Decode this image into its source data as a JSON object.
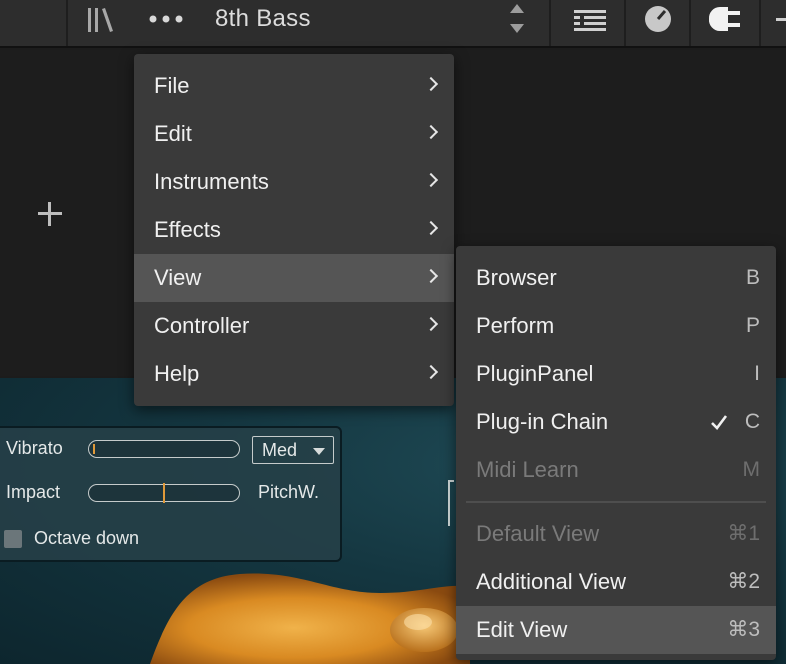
{
  "toolbar": {
    "instrument_name": "8th Bass",
    "icons": [
      "library-icon",
      "more-icon",
      "stepper-icon",
      "list-icon",
      "knob-icon",
      "plug-icon",
      "minus-icon"
    ]
  },
  "rack": {
    "add_icon": "plus-icon"
  },
  "controls": {
    "vibrato_label": "Vibrato",
    "vibrato_mode": "Med",
    "impact_label": "Impact",
    "pitchw_label": "PitchW.",
    "octave_label": "Octave down",
    "octave_checked": false
  },
  "main_menu": {
    "items": [
      {
        "label": "File",
        "has_submenu": true
      },
      {
        "label": "Edit",
        "has_submenu": true
      },
      {
        "label": "Instruments",
        "has_submenu": true
      },
      {
        "label": "Effects",
        "has_submenu": true
      },
      {
        "label": "View",
        "has_submenu": true,
        "highlighted": true
      },
      {
        "label": "Controller",
        "has_submenu": true
      },
      {
        "label": "Help",
        "has_submenu": true
      }
    ]
  },
  "view_menu": {
    "items": [
      {
        "label": "Browser",
        "shortcut": "B",
        "enabled": true
      },
      {
        "label": "Perform",
        "shortcut": "P",
        "enabled": true
      },
      {
        "label": "PluginPanel",
        "shortcut": "I",
        "enabled": true
      },
      {
        "label": "Plug-in Chain",
        "shortcut": "C",
        "enabled": true,
        "checked": true
      },
      {
        "label": "Midi Learn",
        "shortcut": "M",
        "enabled": false
      }
    ],
    "view_items": [
      {
        "label": "Default View",
        "shortcut": "⌘1",
        "enabled": false
      },
      {
        "label": "Additional View",
        "shortcut": "⌘2",
        "enabled": true
      },
      {
        "label": "Edit View",
        "shortcut": "⌘3",
        "enabled": true,
        "highlighted": true
      }
    ]
  },
  "colors": {
    "menu_bg": "#3a3a3a",
    "menu_highlight": "#555555",
    "toolbar_bg": "#2d2d2d",
    "accent_orange": "#e09a3a"
  }
}
